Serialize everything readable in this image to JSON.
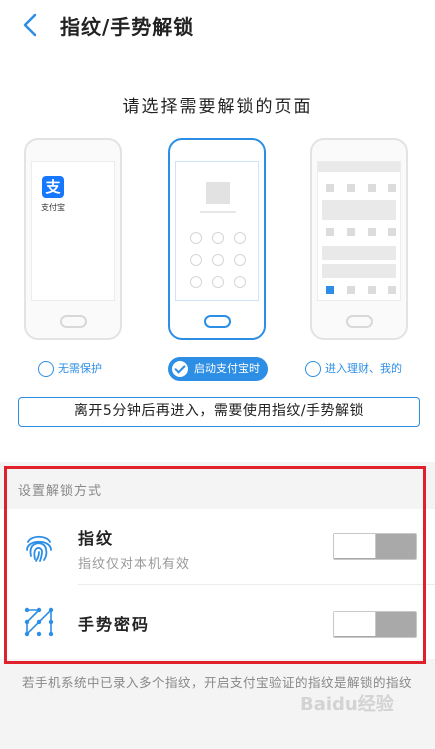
{
  "header": {
    "title": "指纹/手势解锁",
    "back_icon": "chevron-left-icon",
    "accent_color": "#2d8ee6"
  },
  "panel": {
    "prompt": "请选择需要解锁的页面",
    "phones": [
      {
        "app_name": "支付宝",
        "logo_glyph": "支"
      },
      {
        "screen": "gesture-lock"
      },
      {
        "screen": "wealth-page"
      }
    ],
    "options": [
      {
        "label": "无需保护",
        "selected": false
      },
      {
        "label": "启动支付宝时",
        "selected": true
      },
      {
        "label": "进入理财、我的",
        "selected": false
      }
    ],
    "notice": "离开5分钟后再进入，需要使用指纹/手势解锁"
  },
  "section": {
    "label": "设置解锁方式",
    "rows": [
      {
        "title": "指纹",
        "subtitle": "指纹仅对本机有效",
        "icon": "fingerprint-icon",
        "enabled": false
      },
      {
        "title": "手势密码",
        "icon": "gesture-pattern-icon",
        "enabled": false
      }
    ]
  },
  "footnote": "若手机系统中已录入多个指纹，开启支付宝验证的指纹是解锁的指纹",
  "watermark": "Baidu经验",
  "highlight_color": "#e0202a"
}
